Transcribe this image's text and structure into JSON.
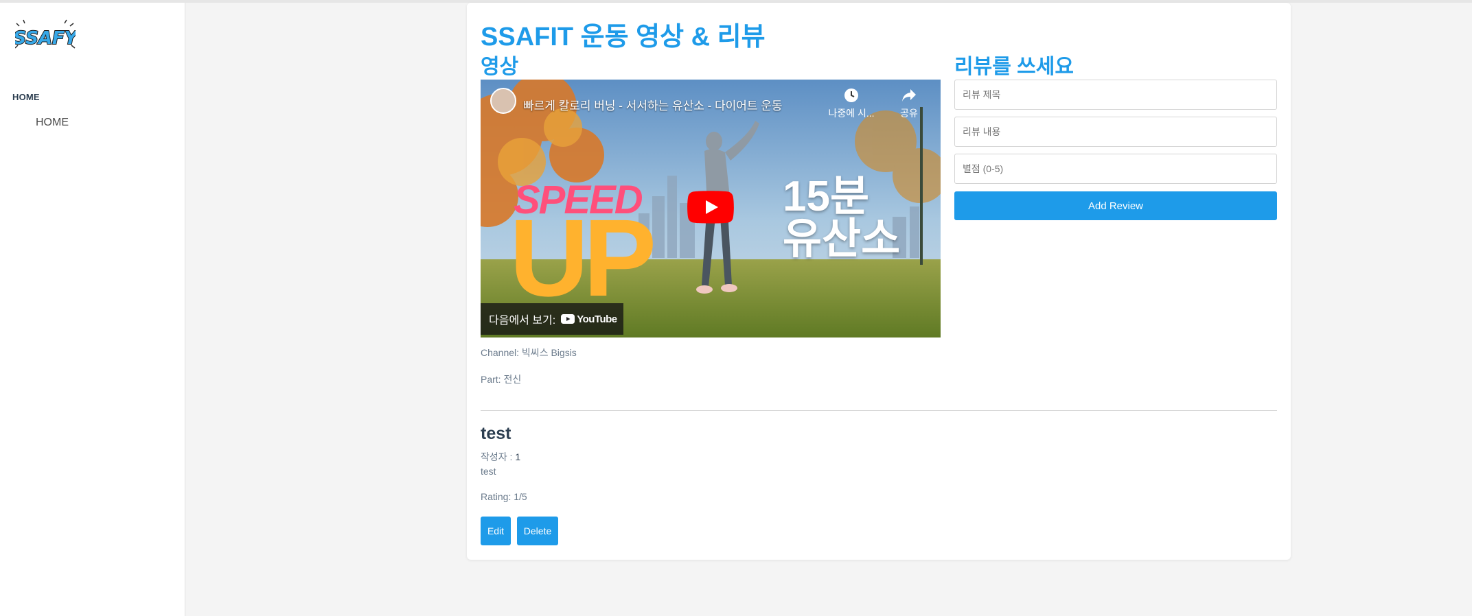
{
  "sidebar": {
    "logo_text": "SSAFY",
    "section_label": "HOME",
    "items": [
      {
        "label": "HOME"
      }
    ]
  },
  "page": {
    "title": "SSAFIT 운동 영상 & 리뷰",
    "video_heading": "영상",
    "review_form_heading": "리뷰를 쓰세요"
  },
  "video": {
    "title": "빠르게 칼로리 버닝 - 서서하는 유산소 - 다이어트 운동",
    "watch_later_label": "나중에 시...",
    "share_label": "공유",
    "watch_on_label": "다음에서 보기:",
    "youtube_label": "YouTube",
    "thumb_text_speed": "SPEED",
    "thumb_text_up": "UP",
    "thumb_text_ko_line1": "15분",
    "thumb_text_ko_line2": "유산소",
    "channel_line": "Channel: 빅씨스 Bigsis",
    "part_line": "Part: 전신"
  },
  "form": {
    "title_placeholder": "리뷰 제목",
    "content_placeholder": "리뷰 내용",
    "rating_placeholder": "별점 (0-5)",
    "submit_label": "Add Review"
  },
  "reviews": [
    {
      "title": "test",
      "author_label": "작성자 : ",
      "author": "1",
      "content": "test",
      "rating_line": "Rating: 1/5",
      "edit_label": "Edit",
      "delete_label": "Delete"
    }
  ],
  "colors": {
    "accent": "#1e9be9",
    "heading_text": "#2c3e50",
    "muted_text": "#6b7b8c",
    "background": "#f4f4f4",
    "youtube_red": "#ff0000"
  }
}
